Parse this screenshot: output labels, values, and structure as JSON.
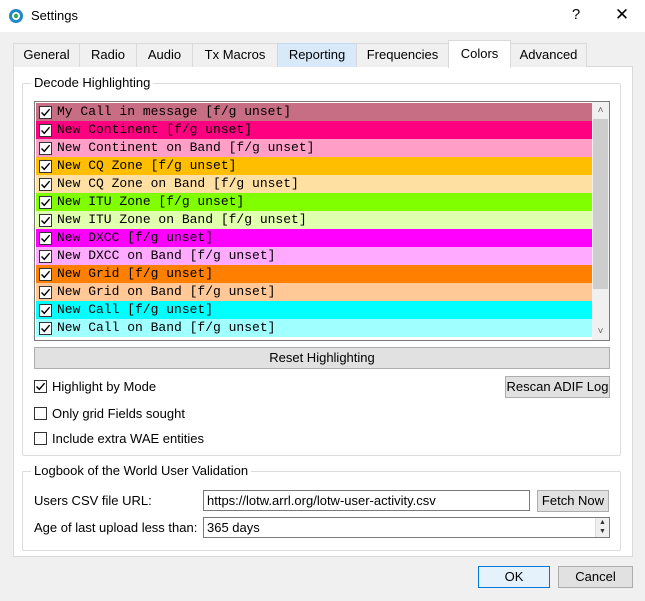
{
  "window": {
    "title": "Settings",
    "help_glyph": "?",
    "close_glyph": "✕",
    "icon": "wsjtx-app-icon"
  },
  "tabs": [
    {
      "label": "General",
      "state": "normal"
    },
    {
      "label": "Radio",
      "state": "normal"
    },
    {
      "label": "Audio",
      "state": "normal"
    },
    {
      "label": "Tx Macros",
      "state": "normal"
    },
    {
      "label": "Reporting",
      "state": "hover"
    },
    {
      "label": "Frequencies",
      "state": "normal"
    },
    {
      "label": "Colors",
      "state": "active"
    },
    {
      "label": "Advanced",
      "state": "normal"
    }
  ],
  "decode_highlighting": {
    "title": "Decode Highlighting",
    "items": [
      {
        "label": "My Call in message [f/g unset]",
        "checked": true,
        "bg": "#c86e84"
      },
      {
        "label": "New Continent [f/g unset]",
        "checked": true,
        "bg": "#ff0080"
      },
      {
        "label": "New Continent on Band [f/g unset]",
        "checked": true,
        "bg": "#ff9fc8"
      },
      {
        "label": "New CQ Zone [f/g unset]",
        "checked": true,
        "bg": "#ffbf00"
      },
      {
        "label": "New CQ Zone on Band [f/g unset]",
        "checked": true,
        "bg": "#ffe0a3"
      },
      {
        "label": "New ITU Zone [f/g unset]",
        "checked": true,
        "bg": "#80ff00"
      },
      {
        "label": "New ITU Zone on Band [f/g unset]",
        "checked": true,
        "bg": "#dfffaf"
      },
      {
        "label": "New DXCC [f/g unset]",
        "checked": true,
        "bg": "#ff00ff"
      },
      {
        "label": "New DXCC on Band [f/g unset]",
        "checked": true,
        "bg": "#ffaaff"
      },
      {
        "label": "New Grid [f/g unset]",
        "checked": true,
        "bg": "#ff8000"
      },
      {
        "label": "New Grid on Band [f/g unset]",
        "checked": true,
        "bg": "#ffc896"
      },
      {
        "label": "New Call [f/g unset]",
        "checked": true,
        "bg": "#00ffff"
      },
      {
        "label": "New Call on Band [f/g unset]",
        "checked": true,
        "bg": "#a0ffff"
      }
    ],
    "scroll_up_glyph": "˄",
    "scroll_down_glyph": "˅",
    "reset_button": "Reset Highlighting",
    "rescan_button": "Rescan ADIF Log",
    "options": [
      {
        "label": "Highlight by Mode",
        "checked": true
      },
      {
        "label": "Only grid Fields sought",
        "checked": false
      },
      {
        "label": "Include extra WAE entities",
        "checked": false
      }
    ]
  },
  "lotw": {
    "title": "Logbook of the World User Validation",
    "url_label": "Users CSV file URL:",
    "url_value": "https://lotw.arrl.org/lotw-user-activity.csv",
    "fetch_button": "Fetch Now",
    "age_label": "Age of last upload less than:",
    "age_value": "365 days"
  },
  "dialog_buttons": {
    "ok": "OK",
    "cancel": "Cancel"
  }
}
